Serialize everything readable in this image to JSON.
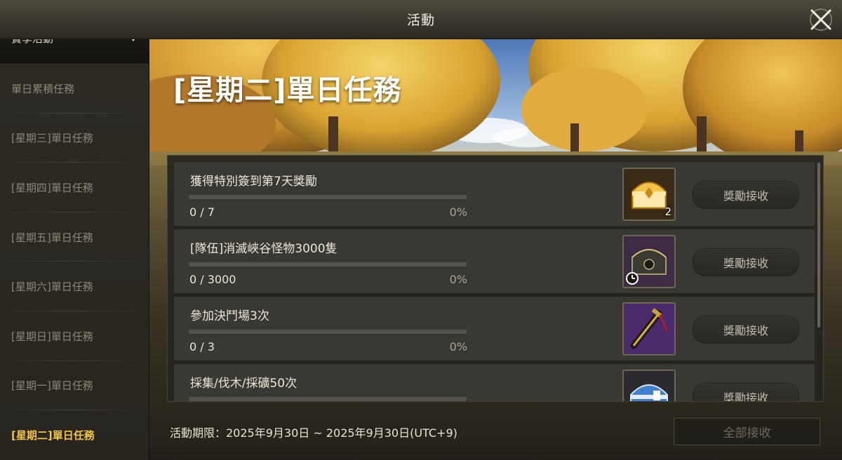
{
  "window": {
    "title": "活動"
  },
  "sidebar": {
    "header_label": "賞季活動",
    "items": [
      {
        "label": "單日累積任務"
      },
      {
        "label": "[星期三]單日任務"
      },
      {
        "label": "[星期四]單日任務"
      },
      {
        "label": "[星期五]單日任務"
      },
      {
        "label": "[星期六]單日任務"
      },
      {
        "label": "[星期日]單日任務"
      },
      {
        "label": "[星期一]單日任務"
      },
      {
        "label": "[星期二]單日任務",
        "active": true
      }
    ]
  },
  "event": {
    "title": "[星期二]單日任務",
    "quests": [
      {
        "name": "獲得特別簽到第7天獎勵",
        "progress": "0 / 7",
        "percent": "0%",
        "progress_fraction": 0,
        "reward_icon": "golden-chest-icon",
        "reward_qty": "2",
        "claim_label": "獎勵接收"
      },
      {
        "name": "[隊伍]消滅峽谷怪物3000隻",
        "progress": "0 / 3000",
        "percent": "0%",
        "progress_fraction": 0,
        "reward_icon": "dark-chest-icon",
        "claim_label": "獎勵接收"
      },
      {
        "name": "參加決鬥場3次",
        "progress": "0 / 3",
        "percent": "0%",
        "progress_fraction": 0,
        "reward_icon": "sword-hilt-icon",
        "claim_label": "獎勵接收"
      },
      {
        "name": "採集/伐木/採礦50次",
        "progress": "",
        "percent": "",
        "progress_fraction": 0,
        "reward_icon": "blue-chest-icon",
        "claim_label": "獎勵接收"
      }
    ],
    "period": "活動期限：2025年9月30日 ~ 2025年9月30日(UTC+9)",
    "claim_all_label": "全部接收"
  },
  "colors": {
    "accent": "#f2c24b",
    "active_tab": "#f2c24b",
    "inactive_tab": "#8d877b"
  }
}
